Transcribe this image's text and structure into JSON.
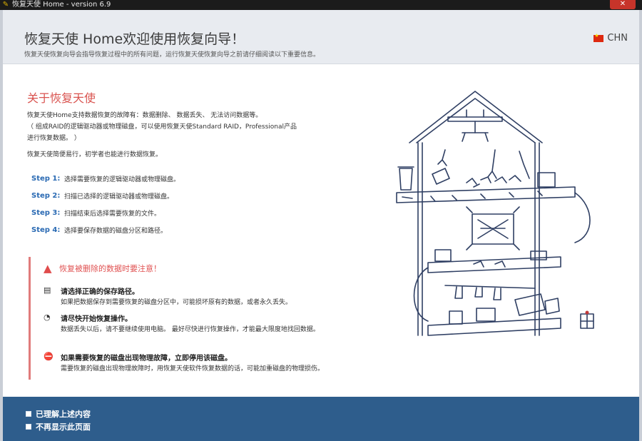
{
  "window": {
    "title": "恢复天使 Home - version 6.9",
    "close_label": "✕"
  },
  "header": {
    "title": "恢复天使 Home欢迎使用恢复向导！",
    "subtitle": "恢复天使恢复向导会指导恢复过程中的所有问题，运行恢复天使恢复向导之前请仔细阅读以下重要信息。",
    "language": "CHN"
  },
  "about": {
    "title": "关于恢复天使",
    "paragraph1": [
      "恢复天使Home支持数据恢复的故障有：数据删除、 数据丢失、 无法访问数据等。",
      "（ 组成RAID的逻辑驱动器或物理磁盘，可以使用恢复天使Standard RAID，Professional产品",
      "进行恢复数据。 ）"
    ],
    "paragraph2": "恢复天使简便易行，初学者也能进行数据恢复。",
    "steps": [
      {
        "label": "Step 1:",
        "text": "选择需要恢复的逻辑驱动器或物理磁盘。"
      },
      {
        "label": "Step 2:",
        "text": "扫描已选择的逻辑驱动器或物理磁盘。"
      },
      {
        "label": "Step 3:",
        "text": "扫描结束后选择需要恢复的文件。"
      },
      {
        "label": "Step 4:",
        "text": "选择要保存数据的磁盘分区和路径。"
      }
    ]
  },
  "warning": {
    "title": "恢复被删除的数据时要注意！",
    "tips": [
      {
        "icon": "disk-icon",
        "title": "请选择正确的保存路径。",
        "desc": "如果把数据保存到需要恢复的磁盘分区中，可能损坏原有的数据，或者永久丢失。"
      },
      {
        "icon": "clock-icon",
        "title": "请尽快开始恢复操作。",
        "desc": "数据丢失以后，请不要继续使用电脑。 最好尽快进行恢复操作，才能最大限度地找回数据。"
      },
      {
        "icon": "drive-warning-icon",
        "title": "如果需要恢复的磁盘出现物理故障，立即停用该磁盘。",
        "desc": "需要恢复的磁盘出现物理故障时，用恢复天使软件恢复数据的话，可能加重磁盘的物理损伤。"
      }
    ]
  },
  "footer": {
    "checkboxes": [
      {
        "label": "已理解上述内容",
        "checked": false
      },
      {
        "label": "不再显示此页面",
        "checked": false
      }
    ]
  },
  "colors": {
    "accent_red": "#d9534f",
    "step_blue": "#2a6ab3",
    "footer_blue": "#2e5d8c"
  }
}
